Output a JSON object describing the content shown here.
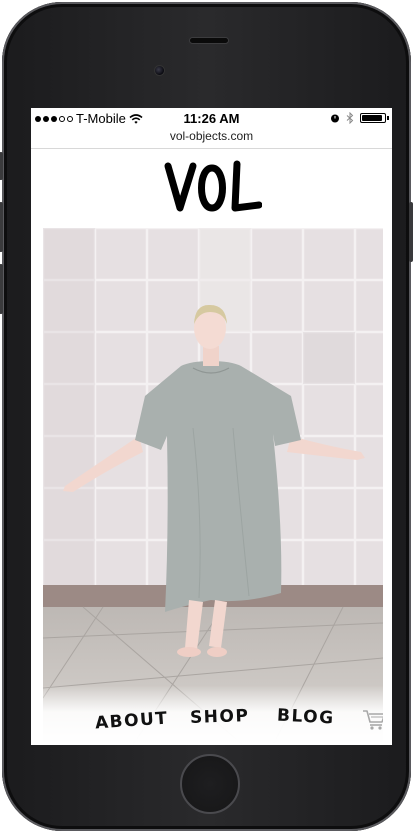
{
  "status_bar": {
    "carrier": "T-Mobile",
    "time": "11:26 AM",
    "signal_dots": [
      true,
      true,
      true,
      false,
      false
    ],
    "battery_level": 0.9
  },
  "browser": {
    "url": "vol-objects.com"
  },
  "site": {
    "logo_alt": "VOL"
  },
  "hero": {
    "photo": "woman-in-grey-dress-arms-outstretched"
  },
  "nav": {
    "items": [
      {
        "label": "ABOUT"
      },
      {
        "label": "SHOP"
      },
      {
        "label": "BLOG"
      }
    ],
    "cart_icon": "cart-icon"
  },
  "colors": {
    "dress": "#a9b0ae",
    "tile_wall": "#e3dddf",
    "floor": "#c8c4c1"
  }
}
